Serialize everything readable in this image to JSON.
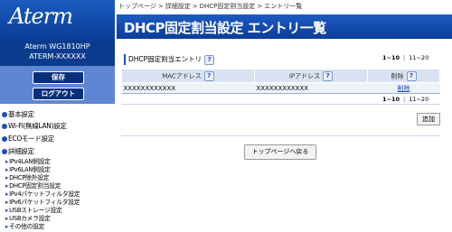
{
  "brand": {
    "logo": "Aterm",
    "model": "Aterm WG1810HP",
    "device_name": "ATERM-XXXXXX"
  },
  "sidebar": {
    "save_label": "保存",
    "logout_label": "ログアウト",
    "menu": [
      {
        "label": "基本設定"
      },
      {
        "label": "Wi-Fi(無線LAN)設定"
      },
      {
        "label": "ECOモード設定"
      },
      {
        "label": "詳細設定"
      }
    ],
    "submenu": [
      {
        "label": "IPv4LAN側設定"
      },
      {
        "label": "IPv6LAN側設定"
      },
      {
        "label": "DHCP除外設定"
      },
      {
        "label": "DHCP固定割当設定"
      },
      {
        "label": "IPv4パケットフィルタ設定"
      },
      {
        "label": "IPv6パケットフィルタ設定"
      },
      {
        "label": "USBストレージ設定"
      },
      {
        "label": "USBカメラ設定"
      },
      {
        "label": "その他の設定"
      }
    ]
  },
  "breadcrumb": [
    "トップページ",
    "詳細設定",
    "DHCP固定割当設定",
    "エントリ一覧"
  ],
  "breadcrumb_sep": ">",
  "page": {
    "title": "DHCP固定割当設定 エントリ一覧",
    "section_title": "DHCP固定割当エントリ",
    "help_glyph": "?",
    "pager": {
      "current": "1~10",
      "next": "11~20"
    },
    "table": {
      "headers": [
        "MACアドレス",
        "IPアドレス",
        "削除"
      ],
      "rows": [
        {
          "mac": "XXXXXXXXXXXX",
          "ip": "XXXXXXXXXXXX",
          "delete": "削除"
        }
      ]
    },
    "add_label": "追加",
    "top_page_label": "トップページへ戻る"
  },
  "colors": {
    "brand_blue": "#0b3d98",
    "sidebar_strip": "#5e86d2",
    "table_header": "#d9e2f2"
  }
}
